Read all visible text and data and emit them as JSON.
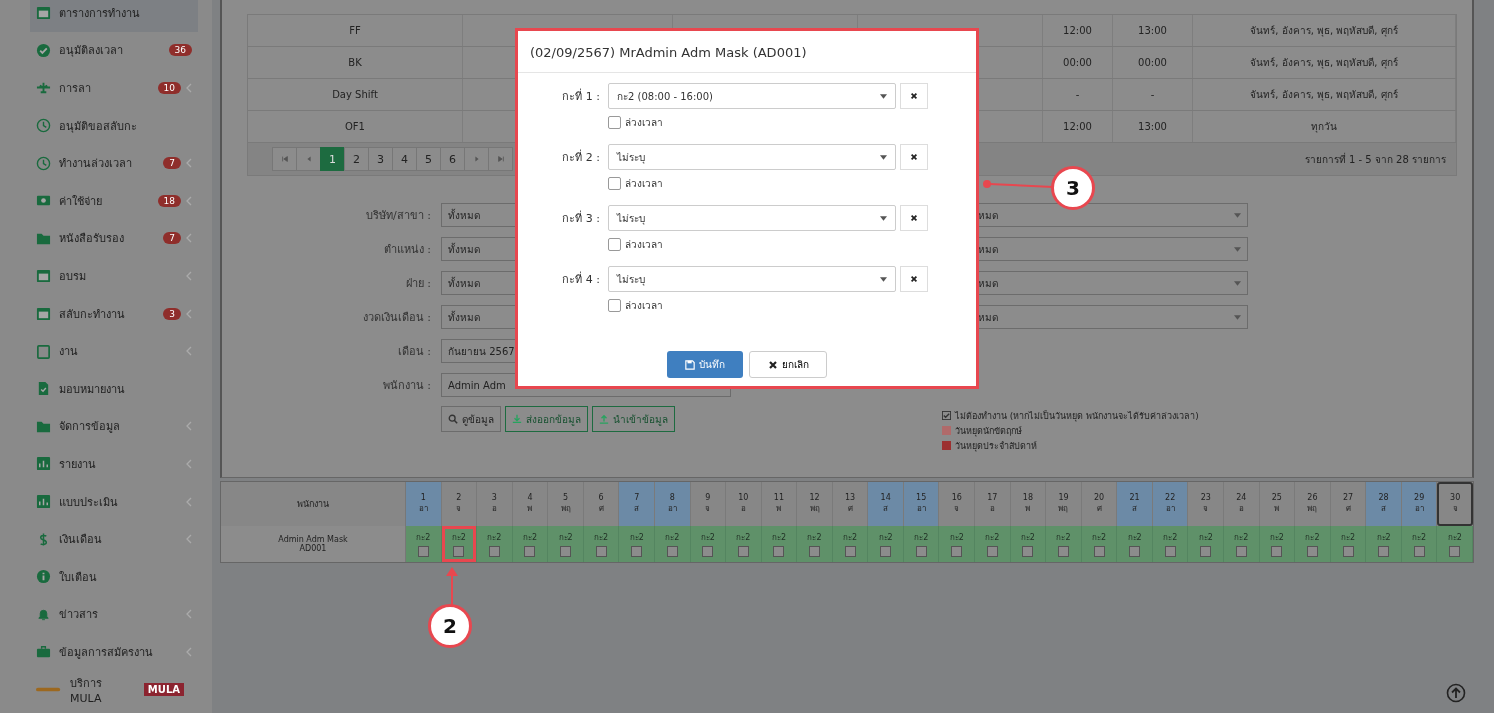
{
  "sidebar": {
    "items": [
      {
        "label": "ตารางการทำงาน",
        "selected": true,
        "expandable": false
      },
      {
        "label": "อนุมัติลงเวลา",
        "badge": "36",
        "selected": false,
        "expandable": false
      },
      {
        "label": "การลา",
        "badge": "10",
        "selected": false,
        "expandable": true
      },
      {
        "label": "อนุมัติขอสลับกะ",
        "selected": false,
        "expandable": false
      },
      {
        "label": "ทำงานล่วงเวลา",
        "badge": "7",
        "selected": false,
        "expandable": true
      },
      {
        "label": "ค่าใช้จ่าย",
        "badge": "18",
        "selected": false,
        "expandable": true
      },
      {
        "label": "หนังสือรับรอง",
        "badge": "7",
        "selected": false,
        "expandable": true
      },
      {
        "label": "อบรม",
        "selected": false,
        "expandable": true
      },
      {
        "label": "สลับกะทำงาน",
        "badge": "3",
        "selected": false,
        "expandable": true
      },
      {
        "label": "งาน",
        "selected": false,
        "expandable": true
      },
      {
        "label": "มอบหมายงาน",
        "selected": false,
        "expandable": false
      },
      {
        "label": "จัดการข้อมูล",
        "selected": false,
        "expandable": true
      },
      {
        "label": "รายงาน",
        "selected": false,
        "expandable": true
      },
      {
        "label": "แบบประเมิน",
        "selected": false,
        "expandable": true
      },
      {
        "label": "เงินเดือน",
        "selected": false,
        "expandable": true
      },
      {
        "label": "ใบเตือน",
        "selected": false,
        "expandable": false
      },
      {
        "label": "ข่าวสาร",
        "selected": false,
        "expandable": true
      },
      {
        "label": "ข้อมูลการสมัครงาน",
        "selected": false,
        "expandable": true
      },
      {
        "label": "บริการ MULA",
        "tag": "MULA",
        "selected": false,
        "expandable": false
      }
    ]
  },
  "shift_table": {
    "rows": [
      {
        "name": "FF",
        "start": "12:00",
        "end": "13:00",
        "days": "จันทร์, อังคาร, พุธ, พฤหัสบดี, ศุกร์"
      },
      {
        "name": "BK",
        "start": "00:00",
        "end": "00:00",
        "days": "จันทร์, อังคาร, พุธ, พฤหัสบดี, ศุกร์"
      },
      {
        "name": "Day Shift",
        "start": "-",
        "end": "-",
        "days": "จันทร์, อังคาร, พุธ, พฤหัสบดี, ศุกร์"
      },
      {
        "name": "OF1",
        "start": "12:00",
        "end": "13:00",
        "days": "ทุกวัน"
      }
    ],
    "pages": [
      {
        "label": "1",
        "selected": true
      },
      {
        "label": "2",
        "selected": false
      },
      {
        "label": "3",
        "selected": false
      },
      {
        "label": "4",
        "selected": false
      },
      {
        "label": "5",
        "selected": false
      },
      {
        "label": "6",
        "selected": false
      }
    ],
    "summary": "รายการที่ 1 - 5 จาก 28 รายการ"
  },
  "filters": [
    {
      "label": "บริษัท/สาขา :",
      "value": "ทั้งหมด",
      "right_value": "หมด"
    },
    {
      "label": "ตำแหน่ง :",
      "value": "ทั้งหมด",
      "right_value": "หมด"
    },
    {
      "label": "ฝ่าย :",
      "value": "ทั้งหมด",
      "right_value": "หมด"
    },
    {
      "label": "งวดเงินเดือน :",
      "value": "ทั้งหมด",
      "right_value": "หมด"
    },
    {
      "label": "เดือน :",
      "value": "กันยายน 2567"
    },
    {
      "label": "พนักงาน :",
      "value": "Admin Adm"
    }
  ],
  "actions": [
    "ดูข้อมูล",
    "ส่งออกข้อมูล",
    "นำเข้าข้อมูล"
  ],
  "legend": [
    {
      "kind": "check",
      "text": "ไม่ต้องทำงาน (หากไม่เป็นวันหยุด พนักงานจะได้รับค่าล่วงเวลา)"
    },
    {
      "kind": "swatch",
      "color": "#b06a6a",
      "text": "วันหยุดนักขัตฤกษ์"
    },
    {
      "kind": "swatch",
      "color": "#9c3030",
      "text": "วันหยุดประจำสัปดาห์"
    }
  ],
  "calendar": {
    "header": "พนักงาน",
    "days": [
      {
        "num": "1",
        "dow": "อา",
        "weekend": true,
        "today": false
      },
      {
        "num": "2",
        "dow": "จ",
        "weekend": false,
        "today": false
      },
      {
        "num": "3",
        "dow": "อ",
        "weekend": false,
        "today": false
      },
      {
        "num": "4",
        "dow": "พ",
        "weekend": false,
        "today": false
      },
      {
        "num": "5",
        "dow": "พฤ",
        "weekend": false,
        "today": false
      },
      {
        "num": "6",
        "dow": "ศ",
        "weekend": false,
        "today": false
      },
      {
        "num": "7",
        "dow": "ส",
        "weekend": true,
        "today": false
      },
      {
        "num": "8",
        "dow": "อา",
        "weekend": true,
        "today": false
      },
      {
        "num": "9",
        "dow": "จ",
        "weekend": false,
        "today": false
      },
      {
        "num": "10",
        "dow": "อ",
        "weekend": false,
        "today": false
      },
      {
        "num": "11",
        "dow": "พ",
        "weekend": false,
        "today": false
      },
      {
        "num": "12",
        "dow": "พฤ",
        "weekend": false,
        "today": false
      },
      {
        "num": "13",
        "dow": "ศ",
        "weekend": false,
        "today": false
      },
      {
        "num": "14",
        "dow": "ส",
        "weekend": true,
        "today": false
      },
      {
        "num": "15",
        "dow": "อา",
        "weekend": true,
        "today": false
      },
      {
        "num": "16",
        "dow": "จ",
        "weekend": false,
        "today": false
      },
      {
        "num": "17",
        "dow": "อ",
        "weekend": false,
        "today": false
      },
      {
        "num": "18",
        "dow": "พ",
        "weekend": false,
        "today": false
      },
      {
        "num": "19",
        "dow": "พฤ",
        "weekend": false,
        "today": false
      },
      {
        "num": "20",
        "dow": "ศ",
        "weekend": false,
        "today": false
      },
      {
        "num": "21",
        "dow": "ส",
        "weekend": true,
        "today": false
      },
      {
        "num": "22",
        "dow": "อา",
        "weekend": true,
        "today": false
      },
      {
        "num": "23",
        "dow": "จ",
        "weekend": false,
        "today": false
      },
      {
        "num": "24",
        "dow": "อ",
        "weekend": false,
        "today": false
      },
      {
        "num": "25",
        "dow": "พ",
        "weekend": false,
        "today": false
      },
      {
        "num": "26",
        "dow": "พฤ",
        "weekend": false,
        "today": false
      },
      {
        "num": "27",
        "dow": "ศ",
        "weekend": false,
        "today": false
      },
      {
        "num": "28",
        "dow": "ส",
        "weekend": true,
        "today": false
      },
      {
        "num": "29",
        "dow": "อา",
        "weekend": true,
        "today": false
      },
      {
        "num": "30",
        "dow": "จ",
        "weekend": false,
        "today": true
      }
    ],
    "employee": {
      "name": "Admin Adm Mask",
      "code": "AD001"
    },
    "cells": [
      {
        "shift": "กะ2",
        "checked": false,
        "selected": false
      },
      {
        "shift": "กะ2",
        "checked": false,
        "selected": true
      },
      {
        "shift": "กะ2",
        "checked": false,
        "selected": false
      },
      {
        "shift": "กะ2",
        "checked": false,
        "selected": false
      },
      {
        "shift": "กะ2",
        "checked": false,
        "selected": false
      },
      {
        "shift": "กะ2",
        "checked": false,
        "selected": false
      },
      {
        "shift": "กะ2",
        "checked": false,
        "selected": false
      },
      {
        "shift": "กะ2",
        "checked": false,
        "selected": false
      },
      {
        "shift": "กะ2",
        "checked": false,
        "selected": false
      },
      {
        "shift": "กะ2",
        "checked": false,
        "selected": false
      },
      {
        "shift": "กะ2",
        "checked": false,
        "selected": false
      },
      {
        "shift": "กะ2",
        "checked": false,
        "selected": false
      },
      {
        "shift": "กะ2",
        "checked": false,
        "selected": false
      },
      {
        "shift": "กะ2",
        "checked": false,
        "selected": false
      },
      {
        "shift": "กะ2",
        "checked": false,
        "selected": false
      },
      {
        "shift": "กะ2",
        "checked": false,
        "selected": false
      },
      {
        "shift": "กะ2",
        "checked": false,
        "selected": false
      },
      {
        "shift": "กะ2",
        "checked": false,
        "selected": false
      },
      {
        "shift": "กะ2",
        "checked": false,
        "selected": false
      },
      {
        "shift": "กะ2",
        "checked": false,
        "selected": false
      },
      {
        "shift": "กะ2",
        "checked": false,
        "selected": false
      },
      {
        "shift": "กะ2",
        "checked": false,
        "selected": false
      },
      {
        "shift": "กะ2",
        "checked": false,
        "selected": false
      },
      {
        "shift": "กะ2",
        "checked": false,
        "selected": false
      },
      {
        "shift": "กะ2",
        "checked": false,
        "selected": false
      },
      {
        "shift": "กะ2",
        "checked": false,
        "selected": false
      },
      {
        "shift": "กะ2",
        "checked": false,
        "selected": false
      },
      {
        "shift": "กะ2",
        "checked": false,
        "selected": false
      },
      {
        "shift": "กะ2",
        "checked": false,
        "selected": false
      },
      {
        "shift": "กะ2",
        "checked": false,
        "selected": false
      }
    ]
  },
  "modal": {
    "title": "(02/09/2567) MrAdmin Adm Mask (AD001)",
    "shifts": [
      {
        "label": "กะที่ 1 :",
        "value": "กะ2 (08:00 - 16:00)",
        "option": "ล่วงเวลา",
        "checked": false
      },
      {
        "label": "กะที่ 2 :",
        "value": "ไม่ระบุ",
        "option": "ล่วงเวลา",
        "checked": false
      },
      {
        "label": "กะที่ 3 :",
        "value": "ไม่ระบุ",
        "option": "ล่วงเวลา",
        "checked": false
      },
      {
        "label": "กะที่ 4 :",
        "value": "ไม่ระบุ",
        "option": "ล่วงเวลา",
        "checked": false
      }
    ],
    "save": "บันทึก",
    "cancel": "ยกเลิก"
  },
  "callouts": [
    {
      "number": "2"
    },
    {
      "number": "3"
    }
  ]
}
